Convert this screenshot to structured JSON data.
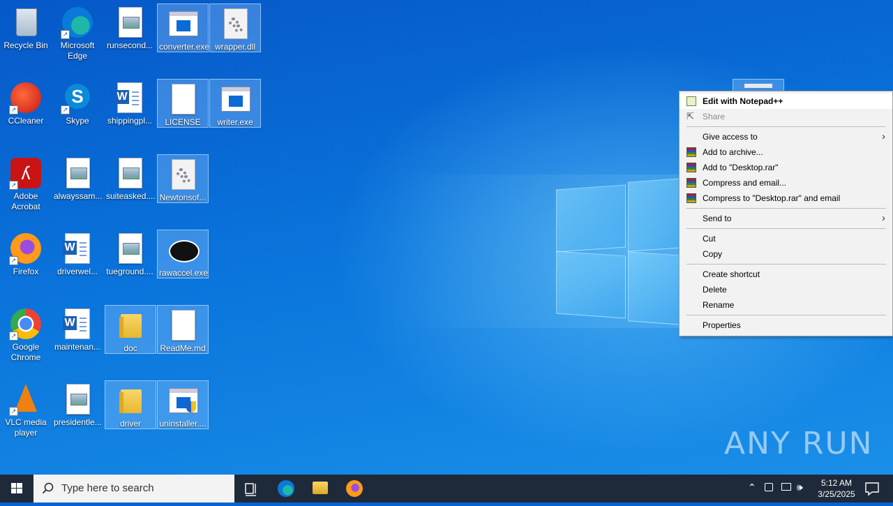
{
  "desktop": {
    "icons": [
      {
        "label": "Recycle Bin"
      },
      {
        "label": "Microsoft Edge"
      },
      {
        "label": "runsecond..."
      },
      {
        "label": "converter.exe"
      },
      {
        "label": "wrapper.dll"
      },
      {
        "label": "CCleaner"
      },
      {
        "label": "Skype"
      },
      {
        "label": "shippingpl..."
      },
      {
        "label": "LICENSE"
      },
      {
        "label": "writer.exe"
      },
      {
        "label": "Adobe Acrobat"
      },
      {
        "label": "alwayssam..."
      },
      {
        "label": "suiteasked...."
      },
      {
        "label": "Newtonsof..."
      },
      {
        "label": "Firefox"
      },
      {
        "label": "driverwel..."
      },
      {
        "label": "tueground...."
      },
      {
        "label": "rawaccel.exe"
      },
      {
        "label": "Google Chrome"
      },
      {
        "label": "maintenan..."
      },
      {
        "label": "doc"
      },
      {
        "label": "ReadMe.md"
      },
      {
        "label": "VLC media player"
      },
      {
        "label": "presidentle..."
      },
      {
        "label": "driver"
      },
      {
        "label": "uninstaller...."
      }
    ]
  },
  "context_menu": {
    "items": [
      {
        "label": "Edit with Notepad++"
      },
      {
        "label": "Share"
      },
      {
        "label": "Give access to"
      },
      {
        "label": "Add to archive..."
      },
      {
        "label": "Add to \"Desktop.rar\""
      },
      {
        "label": "Compress and email..."
      },
      {
        "label": "Compress to \"Desktop.rar\" and email"
      },
      {
        "label": "Send to"
      },
      {
        "label": "Cut"
      },
      {
        "label": "Copy"
      },
      {
        "label": "Create shortcut"
      },
      {
        "label": "Delete"
      },
      {
        "label": "Rename"
      },
      {
        "label": "Properties"
      }
    ]
  },
  "taskbar": {
    "search_placeholder": "Type here to search",
    "time": "5:12 AM",
    "date": "3/25/2025"
  },
  "watermark": "ANY RUN"
}
